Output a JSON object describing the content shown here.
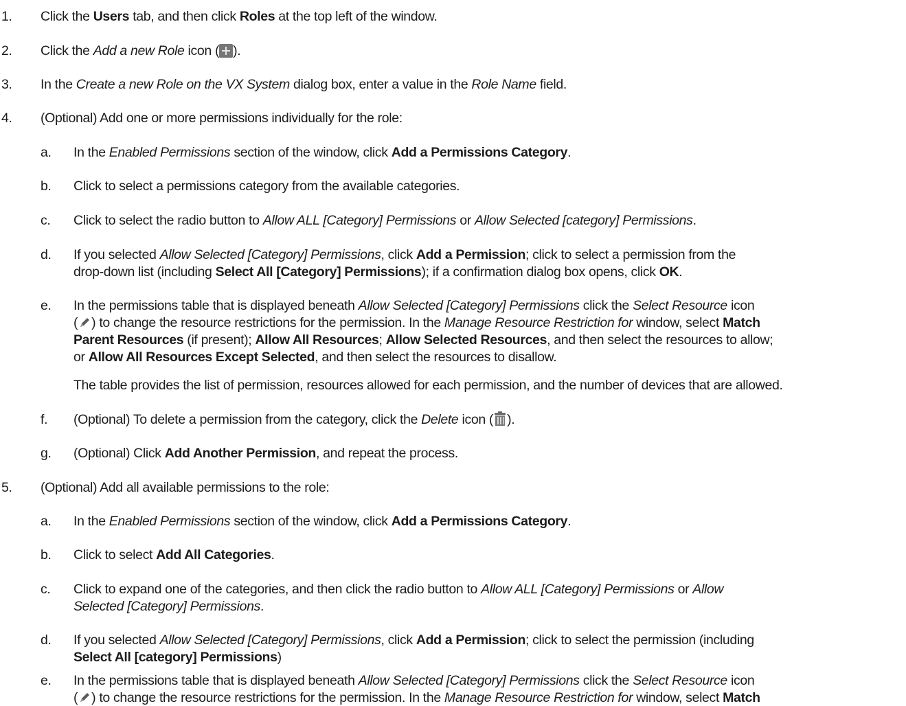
{
  "steps": [
    {
      "marker": "1.",
      "text": [
        "Click the ",
        "Users",
        " tab, and then click ",
        "Roles",
        " at the top left of the window."
      ]
    },
    {
      "marker": "2.",
      "text": [
        "Click the ",
        "Add a new Role",
        " icon (",
        ")."
      ]
    },
    {
      "marker": "3.",
      "text": [
        "In the ",
        "Create a new Role on the VX System",
        " dialog box, enter a value in the ",
        "Role Name",
        " field."
      ]
    },
    {
      "marker": "4.",
      "text": [
        "(Optional) Add one or more permissions individually for the role:"
      ],
      "substeps": [
        {
          "marker": "a.",
          "text": [
            "In the ",
            "Enabled Permissions",
            " section of the window, click ",
            "Add a Permissions Category",
            "."
          ]
        },
        {
          "marker": "b.",
          "text": [
            "Click to select a permissions category from the available categories."
          ]
        },
        {
          "marker": "c.",
          "text": [
            "Click to select the radio button to ",
            "Allow ALL [Category] Permissions",
            " or ",
            "Allow Selected [category] Permissions",
            "."
          ]
        },
        {
          "marker": "d.",
          "text": [
            "If you selected ",
            "Allow Selected [Category] Permissions",
            ", click ",
            "Add a Permission",
            "; click to select a permission from the",
            "drop-down list (including ",
            "Select All [Category] Permissions",
            "); if a confirmation dialog box opens, click ",
            "OK",
            "."
          ]
        },
        {
          "marker": "e.",
          "text": [
            "In the permissions table that is displayed beneath ",
            "Allow Selected [Category] Permissions",
            " click the ",
            "Select Resource",
            " icon",
            "(",
            ") to change the resource restrictions for the permission. In the ",
            "Manage Resource Restriction for",
            " window, select ",
            "Match",
            "Parent Resources",
            " (if present); ",
            "Allow All Resources",
            "; ",
            "Allow Selected Resources",
            ", and then select the resources to allow;",
            "or ",
            "Allow All Resources Except Selected",
            ", and then select the resources to disallow.",
            "The table provides the list of permission, resources allowed for each permission, and the number of devices that are allowed."
          ]
        },
        {
          "marker": "f.",
          "text": [
            "(Optional) To delete a permission from the category, click the ",
            "Delete",
            " icon (",
            ")."
          ]
        },
        {
          "marker": "g.",
          "text": [
            "(Optional) Click ",
            "Add Another Permission",
            ", and repeat the process."
          ]
        }
      ]
    },
    {
      "marker": "5.",
      "text": [
        "(Optional) Add all available permissions to the role:"
      ],
      "substeps": [
        {
          "marker": "a.",
          "text": [
            "In the ",
            "Enabled Permissions",
            " section of the window, click ",
            "Add a Permissions Category",
            "."
          ]
        },
        {
          "marker": "b.",
          "text": [
            "Click to select ",
            "Add All Categories",
            "."
          ]
        },
        {
          "marker": "c.",
          "text": [
            "Click to expand one of the categories, and then click the radio button to ",
            "Allow ALL [Category] Permissions",
            " or ",
            "Allow",
            "Selected [Category] Permissions",
            "."
          ]
        },
        {
          "marker": "d.",
          "text": [
            "If you selected ",
            "Allow Selected [Category] Permissions",
            ", click ",
            "Add a Permission",
            "; click to select the permission (including",
            "Select All [category] Permissions",
            ")"
          ]
        },
        {
          "marker": "e.",
          "text": [
            "In the permissions table that is displayed beneath ",
            "Allow Selected [Category] Permissions",
            " click the ",
            "Select Resource",
            " icon",
            "(",
            ") to change the resource restrictions for the permission. In the ",
            "Manage Resource Restriction for",
            " window, select ",
            "Match"
          ]
        }
      ]
    }
  ]
}
